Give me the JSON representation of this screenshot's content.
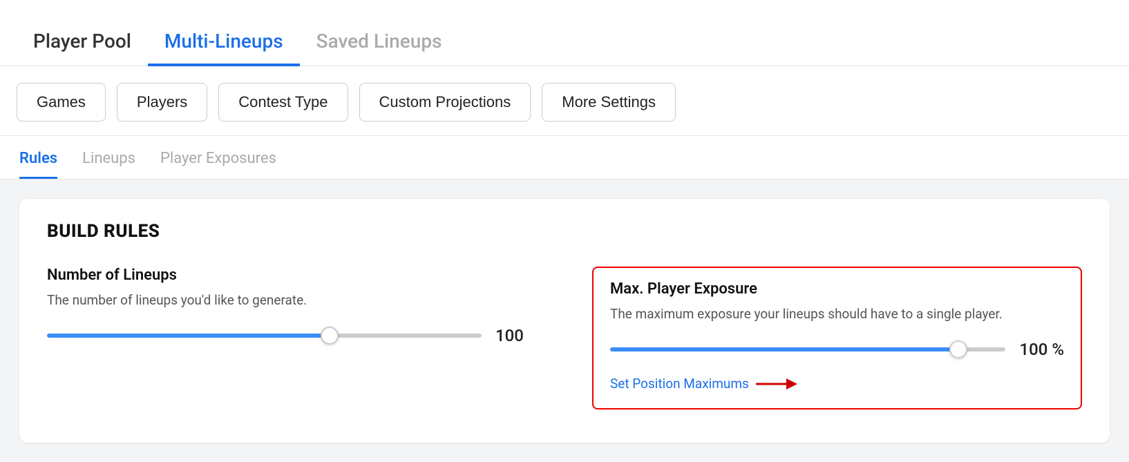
{
  "topNav": {
    "tabs": [
      {
        "id": "player-pool",
        "label": "Player Pool",
        "active": false
      },
      {
        "id": "multi-lineups",
        "label": "Multi-Lineups",
        "active": true
      },
      {
        "id": "saved-lineups",
        "label": "Saved Lineups",
        "active": false
      }
    ]
  },
  "filterButtons": [
    {
      "id": "games",
      "label": "Games"
    },
    {
      "id": "players",
      "label": "Players"
    },
    {
      "id": "contest-type",
      "label": "Contest Type"
    },
    {
      "id": "custom-projections",
      "label": "Custom Projections"
    },
    {
      "id": "more-settings",
      "label": "More Settings"
    }
  ],
  "subTabs": [
    {
      "id": "rules",
      "label": "Rules",
      "active": true
    },
    {
      "id": "lineups",
      "label": "Lineups",
      "active": false
    },
    {
      "id": "player-exposures",
      "label": "Player Exposures",
      "active": false
    }
  ],
  "buildRules": {
    "title": "BUILD RULES",
    "numberOfLineups": {
      "label": "Number of Lineups",
      "desc": "The number of lineups you'd like to generate.",
      "value": 100,
      "percent": 65
    },
    "maxPlayerExposure": {
      "label": "Max. Player Exposure",
      "desc": "The maximum exposure your lineups should have to a single player.",
      "value": "100 %",
      "percent": 90
    },
    "setPositionLink": "Set Position Maximums"
  }
}
